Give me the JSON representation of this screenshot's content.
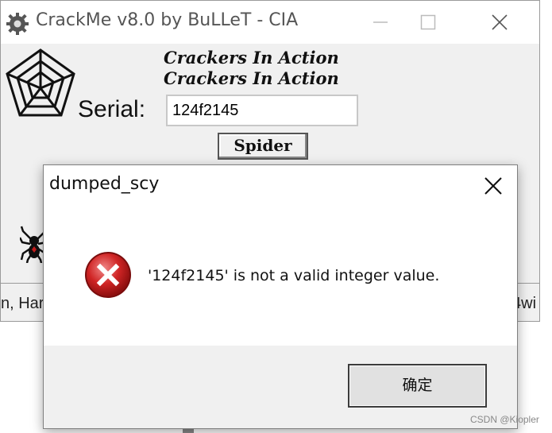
{
  "main_window": {
    "title": "CrackMe v8.0 by BuLLeT - CIA",
    "banner_line1": "Crackers In Action",
    "banner_line2": "Crackers In Action",
    "serial_label": "Serial:",
    "serial_value": "124f2145",
    "spider_button_label": "Spider",
    "status_left": "n, Har",
    "status_right": "4wi",
    "icons": [
      "gear-icon",
      "minimize-icon",
      "maximize-icon",
      "close-icon",
      "spider-web-icon",
      "spider-icon"
    ]
  },
  "dialog": {
    "title": "dumped_scy",
    "message": "'124f2145' is not a valid integer value.",
    "ok_label": "确定",
    "icons": [
      "error-icon",
      "close-icon"
    ],
    "error_color": "#c81e1e"
  },
  "watermark": "CSDN @Kiopler"
}
